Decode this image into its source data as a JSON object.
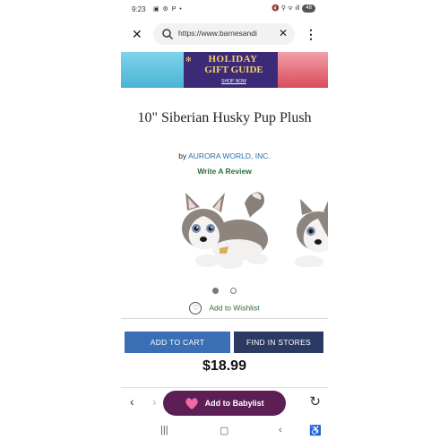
{
  "status_bar": {
    "time": "9:23",
    "left_icons": "▣ ⚙ P •",
    "right_icons": "🔇 ⚲ ᯤ ıll",
    "battery": "48"
  },
  "browser": {
    "url": "https://www.barnesandi",
    "icons": [
      "close-icon",
      "search-icon",
      "clear-icon",
      "more-vert-icon"
    ]
  },
  "banner": {
    "line1": "HOLIDAY",
    "line2": "GIFT GUIDE",
    "cta": "SHOP NOW"
  },
  "product": {
    "title": "10\" Siberian Husky Pup Plush",
    "by_prefix": "by",
    "brand": "AURORA WORLD, INC.",
    "review_link": "Write A Review",
    "wishlist": "Add to Wishlist",
    "add_to_cart": "ADD TO CART",
    "find_in_stores": "FIND IN STORES",
    "price": "$18.99"
  },
  "carousel": {
    "pages": 2,
    "active_index": 0
  },
  "bottom_bar": {
    "babylist_label": "Add to Babylist"
  },
  "colors": {
    "accent_blue": "#3a6fb6",
    "navy": "#2b3a63",
    "green_link": "#2e6d3a",
    "babylist_purple": "#5b1f56"
  }
}
